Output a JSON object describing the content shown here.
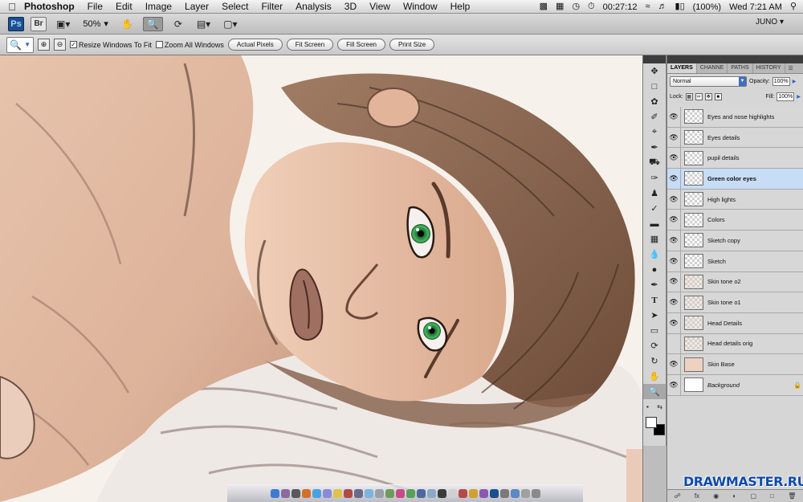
{
  "menubar": {
    "app_name": "Photoshop",
    "items": [
      "File",
      "Edit",
      "Image",
      "Layer",
      "Select",
      "Filter",
      "Analysis",
      "3D",
      "View",
      "Window",
      "Help"
    ],
    "clock_timer": "00:27:12",
    "battery": "(100%)",
    "datetime": "Wed 7:21 AM"
  },
  "appbar": {
    "ps_logo": "Ps",
    "br_logo": "Br",
    "zoom": "50%",
    "workspace": "JUNO"
  },
  "options": {
    "resize_windows_label": "Resize Windows To Fit",
    "resize_windows_checked": true,
    "zoom_all_label": "Zoom All Windows",
    "zoom_all_checked": false,
    "buttons": [
      "Actual Pixels",
      "Fit Screen",
      "Fill Screen",
      "Print Size"
    ]
  },
  "panel": {
    "tabs": [
      "LAYERS",
      "CHANNE",
      "PATHS",
      "HISTORY"
    ],
    "blend_mode": "Normal",
    "opacity_label": "Opacity:",
    "opacity": "100%",
    "lock_label": "Lock:",
    "fill_label": "Fill:",
    "fill": "100%",
    "layers": [
      {
        "name": "Eyes and nose highlights",
        "visible": true,
        "thumb": "trans"
      },
      {
        "name": "Eyes details",
        "visible": true,
        "thumb": "trans"
      },
      {
        "name": "pupil details",
        "visible": true,
        "thumb": "trans"
      },
      {
        "name": "Green color eyes",
        "visible": true,
        "thumb": "trans",
        "selected": true
      },
      {
        "name": "High lights",
        "visible": true,
        "thumb": "trans"
      },
      {
        "name": "Colors",
        "visible": true,
        "thumb": "trans"
      },
      {
        "name": "Sketch copy",
        "visible": true,
        "thumb": "trans"
      },
      {
        "name": "Sketch",
        "visible": true,
        "thumb": "trans"
      },
      {
        "name": "Skin tone o2",
        "visible": true,
        "thumb": "sketchy"
      },
      {
        "name": "Skin tone o1",
        "visible": true,
        "thumb": "sketchy"
      },
      {
        "name": "Head Details",
        "visible": true,
        "thumb": "sketchy"
      },
      {
        "name": "Head details orig",
        "visible": false,
        "thumb": "sketchy"
      },
      {
        "name": "Skin Base",
        "visible": true,
        "thumb": "skin"
      },
      {
        "name": "Background",
        "visible": true,
        "thumb": "white",
        "italic": true,
        "locked": true
      }
    ]
  },
  "watermark": "DRAWMASTER.RU",
  "colors": {
    "selection": "#c7dcf5",
    "skin": "#e9c4ad",
    "hair": "#8f6a52",
    "eyes": "#2f9a4a"
  }
}
